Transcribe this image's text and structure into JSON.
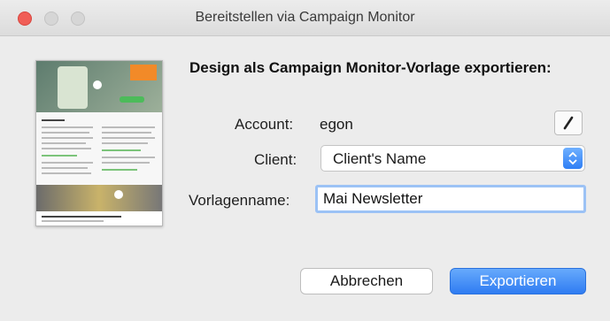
{
  "window": {
    "title": "Bereitstellen via Campaign Monitor"
  },
  "dialog": {
    "heading": "Design als Campaign Monitor-Vorlage exportieren:",
    "account_label": "Account:",
    "account_value": "egon",
    "client_label": "Client:",
    "client_value": "Client's Name",
    "template_label": "Vorlagenname:",
    "template_value": "Mai Newsletter"
  },
  "buttons": {
    "cancel": "Abbrechen",
    "export": "Exportieren"
  },
  "icons": {
    "edit": "pencil-icon",
    "select": "up-down-chevron-icon"
  },
  "colors": {
    "accent": "#2f7cf2",
    "close": "#f05e57",
    "focus_ring": "#9cc2f5"
  }
}
